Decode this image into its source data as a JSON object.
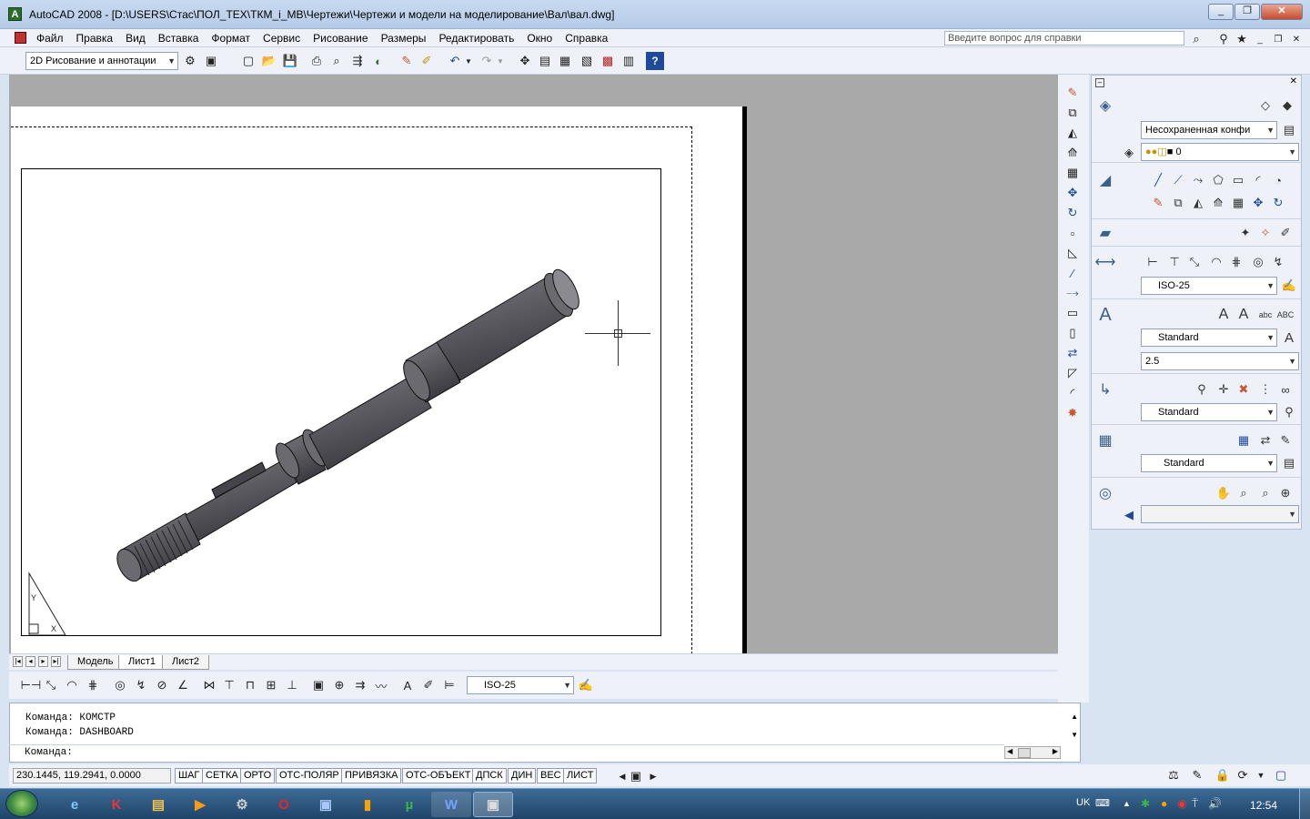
{
  "window": {
    "title": "AutoCAD 2008 - [D:\\USERS\\Стас\\ПОЛ_ТЕХ\\ТКМ_i_МВ\\Чертежи\\Чертежи и модели на моделирование\\Вал\\вал.dwg]",
    "app_icon": "A",
    "minimize": "_",
    "restore": "❐",
    "close": "✕"
  },
  "menu": [
    "Файл",
    "Правка",
    "Вид",
    "Вставка",
    "Формат",
    "Сервис",
    "Рисование",
    "Размеры",
    "Редактировать",
    "Окно",
    "Справка"
  ],
  "help": {
    "placeholder": "Введите вопрос для справки"
  },
  "toolbar": {
    "workspace": "2D Рисование и аннотации"
  },
  "layout_tabs": [
    "Модель",
    "Лист1",
    "Лист2"
  ],
  "dim_toolbar": {
    "dimstyle": "ISO-25"
  },
  "command": {
    "lines": [
      "Команда: КОМСТР",
      "Команда: DASHBOARD"
    ],
    "prompt": "Команда:"
  },
  "status": {
    "coords": "230.1445, 119.2941, 0.0000",
    "buttons": [
      "ШАГ",
      "СЕТКА",
      "ОРТО",
      "ОТС-ПОЛЯР",
      "ПРИВЯЗКА",
      "ОТС-ОБЪЕКТ",
      "ДПСК",
      "ДИН",
      "ВЕС",
      "ЛИСТ"
    ]
  },
  "dashboard": {
    "layer_state": "Несохраненная конфи",
    "layer": "0",
    "dim_style": "ISO-25",
    "text_style": "Standard",
    "text_height": "2.5",
    "mleader_style": "Standard",
    "table_style": "Standard"
  },
  "taskbar": {
    "lang": "UK",
    "clock": "12:54"
  },
  "colors": {
    "accent": "#3b5f8f",
    "shaft": "#5a5a60"
  }
}
